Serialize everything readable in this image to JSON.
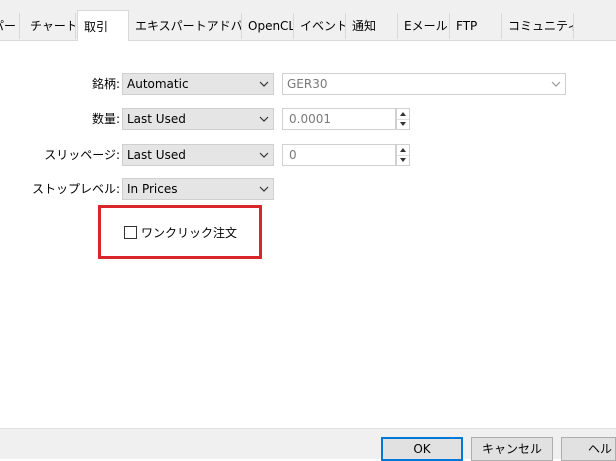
{
  "tabs": [
    {
      "label": "パー",
      "active": false
    },
    {
      "label": "チャート",
      "active": false
    },
    {
      "label": "取引",
      "active": true
    },
    {
      "label": "エキスパートアドバイザ",
      "active": false
    },
    {
      "label": "OpenCL",
      "active": false
    },
    {
      "label": "イベント",
      "active": false
    },
    {
      "label": "通知",
      "active": false
    },
    {
      "label": "Eメール",
      "active": false
    },
    {
      "label": "FTP",
      "active": false
    },
    {
      "label": "コミュニティー",
      "active": false
    }
  ],
  "form": {
    "symbol": {
      "label": "銘柄:",
      "mode": "Automatic",
      "value": "GER30"
    },
    "volume": {
      "label": "数量:",
      "mode": "Last Used",
      "value": "0.0001"
    },
    "slippage": {
      "label": "スリッページ:",
      "mode": "Last Used",
      "value": "0"
    },
    "stop_level": {
      "label": "ストップレベル:",
      "mode": "In Prices"
    },
    "one_click": {
      "label": "ワンクリック注文",
      "checked": false
    }
  },
  "buttons": {
    "ok": "OK",
    "cancel": "キャンセル",
    "help": "ヘルプ"
  },
  "colors": {
    "highlight": "#d9262c",
    "primary_border": "#0078d7"
  }
}
